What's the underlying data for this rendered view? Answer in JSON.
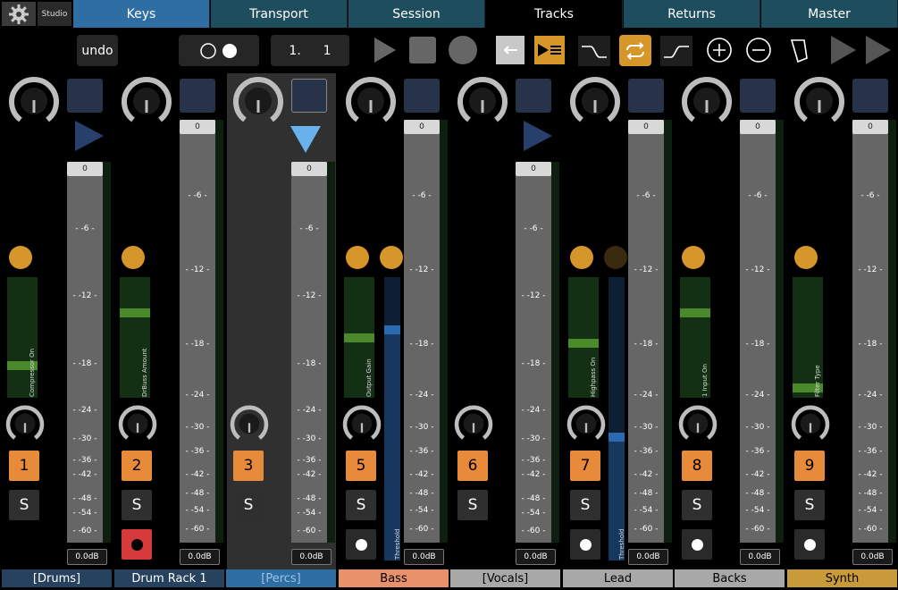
{
  "topbar": {
    "settings_icon": "gear-icon",
    "studio_label": "Studio",
    "tabs": [
      {
        "label": "Keys",
        "state": "blue"
      },
      {
        "label": "Transport",
        "state": "teal"
      },
      {
        "label": "Session",
        "state": "teal"
      },
      {
        "label": "Tracks",
        "state": "active"
      },
      {
        "label": "Returns",
        "state": "teal"
      },
      {
        "label": "Master",
        "state": "teal"
      }
    ]
  },
  "toolbar": {
    "undo_label": "undo",
    "position_bar": "1.",
    "position_beat": "1",
    "icons": [
      "metronome-toggle-icon",
      "play-icon",
      "stop-icon",
      "record-icon",
      "back-arrow-icon",
      "follow-icon",
      "fade-in-icon",
      "loop-icon",
      "fade-out-icon",
      "zoom-in-icon",
      "zoom-out-icon",
      "draw-mode-icon",
      "next-icon",
      "next-icon"
    ]
  },
  "colors": {
    "accent_orange": "#e78a3a",
    "gold": "#d6962a",
    "tab_blue": "#2f6ea3",
    "tab_teal": "#1e4d5e"
  },
  "fader_scale": [
    "0",
    "-6",
    "-12",
    "-18",
    "-24",
    "-30",
    "-36",
    "-42",
    "-48",
    "-54",
    "-60"
  ],
  "long_scale": [
    "0",
    "-6",
    "-12",
    "-18",
    "-24",
    "-30",
    "-36",
    "-42",
    "-48",
    "-54",
    "-60"
  ],
  "volume_readout": "0.0dB",
  "solo_label": "S",
  "tracks": [
    {
      "number": "1",
      "name": "[Drums]",
      "macro_label": "Compressor On",
      "macro_level": 0.25,
      "name_bg": "#26425e",
      "name_color": "#fff"
    },
    {
      "number": "2",
      "name": "Drum Rack 1",
      "macro_label": "DrBuss Amount",
      "macro_level": 0.72,
      "name_bg": "#26425e",
      "name_color": "#fff"
    },
    {
      "number": "3",
      "name": "[Percs]",
      "macro_label": "",
      "macro_level": 0,
      "name_bg": "#2f6ea3",
      "name_color": "#9ec3e6"
    },
    {
      "number": "5",
      "name": "Bass",
      "macro_label": "Output Gain",
      "macro_level": 0.5,
      "macro2_label": "Threshold",
      "name_bg": "#e8916a",
      "name_color": "#000"
    },
    {
      "number": "6",
      "name": "[Vocals]",
      "macro_label": "",
      "macro_level": 0,
      "name_bg": "#a8a8a8",
      "name_color": "#000"
    },
    {
      "number": "7",
      "name": "Lead",
      "macro_label": "Highpass On",
      "macro_level": 0.45,
      "macro2_label": "Threshold",
      "name_bg": "#a8a8a8",
      "name_color": "#000"
    },
    {
      "number": "8",
      "name": "Backs",
      "macro_label": "1 Input On",
      "macro_level": 0.72,
      "name_bg": "#a8a8a8",
      "name_color": "#000"
    },
    {
      "number": "9",
      "name": "Synth",
      "macro_label": "Filter Type",
      "macro_level": 0.05,
      "name_bg": "#c99a3a",
      "name_color": "#000"
    }
  ]
}
